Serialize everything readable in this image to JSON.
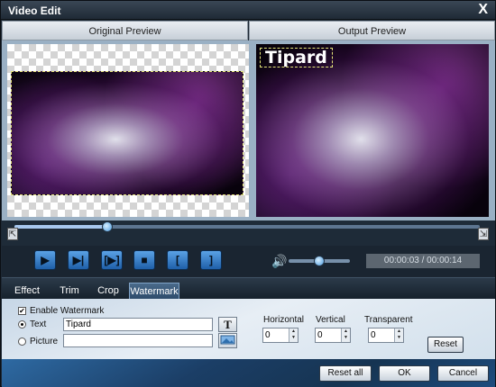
{
  "window": {
    "title": "Video Edit",
    "close_label": "X"
  },
  "preview": {
    "original_label": "Original Preview",
    "output_label": "Output Preview",
    "watermark_text": "Tipard"
  },
  "seek": {
    "position_fraction": 0.2,
    "start_marker": "⇱",
    "end_marker": "⇲"
  },
  "controls": {
    "play_glyph": "▶",
    "step_glyph": "▶|",
    "frame_glyph": "[▶]",
    "stop_glyph": "■",
    "mark_in_glyph": "[",
    "mark_out_glyph": "]",
    "volume_glyph": "🔊",
    "volume_fraction": 0.5,
    "time_display": "00:00:03 / 00:00:14"
  },
  "tabs": [
    {
      "label": "Effect"
    },
    {
      "label": "Trim"
    },
    {
      "label": "Crop"
    },
    {
      "label": "Watermark"
    }
  ],
  "active_tab": "Watermark",
  "watermark": {
    "enable_label": "Enable Watermark",
    "enable_checked": true,
    "text_label": "Text",
    "text_value": "Tipard",
    "picture_label": "Picture",
    "picture_value": "",
    "font_button_glyph": "T",
    "horizontal_label": "Horizontal",
    "horizontal_value": "0",
    "vertical_label": "Vertical",
    "vertical_value": "0",
    "transparent_label": "Transparent",
    "transparent_value": "0",
    "reset_label": "Reset"
  },
  "footer": {
    "reset_all_label": "Reset all",
    "ok_label": "OK",
    "cancel_label": "Cancel"
  },
  "colors": {
    "accent_blue": "#4a9ae0",
    "panel_bg": "#e7eef5",
    "window_dark": "#1d2733"
  },
  "icons": [
    "close-icon",
    "play-icon",
    "next-frame-icon",
    "preview-icon",
    "stop-icon",
    "mark-in-icon",
    "mark-out-icon",
    "volume-icon",
    "font-icon",
    "picture-browse-icon"
  ]
}
